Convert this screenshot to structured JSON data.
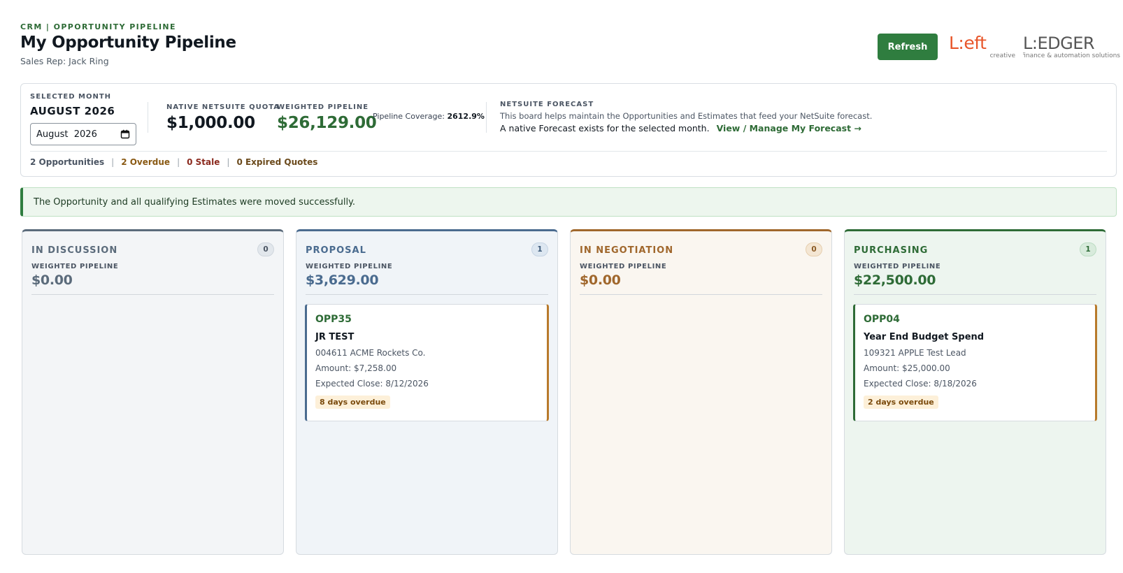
{
  "header": {
    "eyebrow": "CRM | OPPORTUNITY PIPELINE",
    "title": "My Opportunity Pipeline",
    "subtitle": "Sales Rep: Jack Ring",
    "refresh_label": "Refresh",
    "logo_left_text": "L:eft",
    "logo_left_sub": "creative",
    "logo_ledger_text": "L:EDGER",
    "logo_ledger_sub": "finance & automation solutions"
  },
  "summary": {
    "selected_month_label": "SELECTED MONTH",
    "selected_month": "AUGUST 2026",
    "month_input_value": "August  2026",
    "quota_label": "NATIVE NETSUITE QUOTA",
    "quota_value": "$1,000.00",
    "weighted_label": "WEIGHTED PIPELINE",
    "weighted_value": "$26,129.00",
    "coverage_label": "Pipeline Coverage:",
    "coverage_value": "2612.9%",
    "forecast_label": "NETSUITE FORECAST",
    "forecast_desc": "This board helps maintain the Opportunities and Estimates that feed your NetSuite forecast.",
    "forecast_status": "A native Forecast exists for the selected month.",
    "forecast_link": "View / Manage My Forecast →",
    "counts": {
      "opportunities": "2 Opportunities",
      "overdue": "2 Overdue",
      "stale": "0 Stale",
      "expired": "0 Expired Quotes",
      "separator": "|"
    }
  },
  "alert": {
    "message": "The Opportunity and all qualifying Estimates were moved successfully."
  },
  "columns": [
    {
      "name": "IN DISCUSSION",
      "count": "0",
      "wp_label": "WEIGHTED PIPELINE",
      "wp_value": "$0.00"
    },
    {
      "name": "PROPOSAL",
      "count": "1",
      "wp_label": "WEIGHTED PIPELINE",
      "wp_value": "$3,629.00",
      "card": {
        "id": "OPP35",
        "name": "JR TEST",
        "customer": "004611 ACME Rockets Co.",
        "amount": "Amount: $7,258.00",
        "close": "Expected Close: 8/12/2026",
        "overdue": "8 days overdue"
      }
    },
    {
      "name": "IN NEGOTIATION",
      "count": "0",
      "wp_label": "WEIGHTED PIPELINE",
      "wp_value": "$0.00"
    },
    {
      "name": "PURCHASING",
      "count": "1",
      "wp_label": "WEIGHTED PIPELINE",
      "wp_value": "$22,500.00",
      "card": {
        "id": "OPP04",
        "name": "Year End Budget Spend",
        "customer": "109321 APPLE Test Lead",
        "amount": "Amount: $25,000.00",
        "close": "Expected Close: 8/18/2026",
        "overdue": "2 days overdue"
      }
    }
  ],
  "colors": {
    "brand_green": "#2f7d3f",
    "discussion": "#5b6b7b",
    "proposal": "#4a6b8f",
    "negotiation": "#a0672c",
    "purchasing": "#2e6b36",
    "overdue_text": "#8a5a14",
    "stale_text": "#8b2a1e",
    "left_logo": "#e8562a",
    "ledger_logo": "#555555"
  }
}
